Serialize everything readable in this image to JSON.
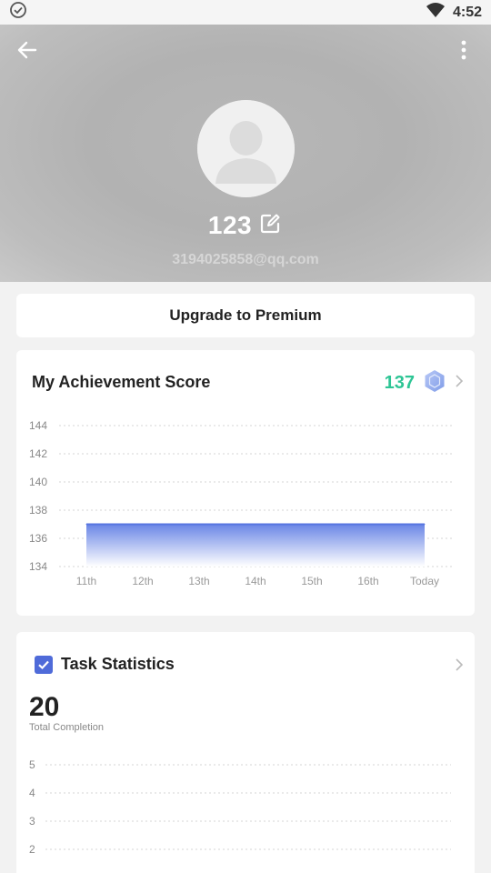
{
  "status_bar": {
    "time": "4:52"
  },
  "profile": {
    "name": "123",
    "email": "3194025858@qq.com"
  },
  "upgrade": {
    "label": "Upgrade to Premium"
  },
  "achievement": {
    "title": "My Achievement Score",
    "score": "137"
  },
  "task": {
    "title": "Task Statistics",
    "total": "20",
    "total_label": "Total Completion"
  },
  "colors": {
    "accent_green": "#2ec595",
    "accent_blue": "#4f6bd9",
    "area_top": "#6a86e6"
  },
  "chart_data": [
    {
      "type": "area",
      "categories": [
        "11th",
        "12th",
        "13th",
        "14th",
        "15th",
        "16th",
        "Today"
      ],
      "values": [
        137,
        137,
        137,
        137,
        137,
        137,
        137
      ],
      "ylim": [
        134,
        144
      ],
      "yticks": [
        144,
        142,
        140,
        138,
        136,
        134
      ],
      "grid": true
    },
    {
      "type": "line",
      "yticks": [
        5,
        4,
        3,
        2
      ],
      "grid": true
    }
  ]
}
